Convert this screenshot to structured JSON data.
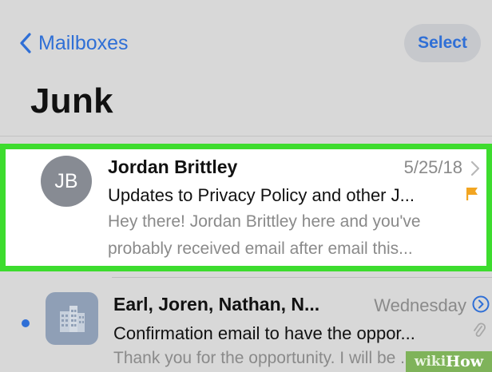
{
  "nav": {
    "back_label": "Mailboxes",
    "select_label": "Select"
  },
  "page": {
    "title": "Junk"
  },
  "colors": {
    "accent": "#2f6fd6",
    "highlight_border": "#3ddc2e",
    "flag": "#f2a521",
    "avatar": "#878b93"
  },
  "messages": [
    {
      "avatar_initials": "JB",
      "sender": "Jordan Brittley",
      "date": "5/25/18",
      "subject": "Updates to Privacy Policy and other J...",
      "preview_line1": "Hey there! Jordan Brittley here and you've",
      "preview_line2": "probably received email after email this...",
      "flagged": true,
      "icons": [
        "chevron-right-icon",
        "flag-icon"
      ]
    },
    {
      "sender": "Earl, Joren, Nathan, N...",
      "date": "Wednesday",
      "subject": "Confirmation email to have the oppor...",
      "preview_line1": "Thank you for the opportunity. I will be ...",
      "unread": true,
      "icons": [
        "building-icon",
        "info-icon",
        "paperclip-icon"
      ]
    }
  ],
  "watermark": {
    "part1": "wiki",
    "part2": "How"
  }
}
